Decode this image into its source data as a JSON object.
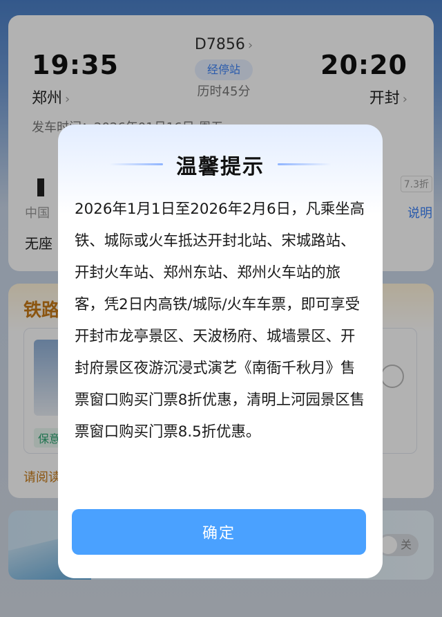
{
  "train": {
    "dep_time": "19:35",
    "dep_station": "郑州",
    "train_no": "D7856",
    "stops_label": "经停站",
    "duration": "历时45分",
    "arr_time": "20:20",
    "arr_station": "开封",
    "depart_date": "发车时间：2026年01月16日 周五"
  },
  "seat": {
    "discount_badge": "7.3折",
    "company": "中国",
    "explain_link": "说明",
    "seat_type": "无座"
  },
  "rail_card": {
    "title": "铁路",
    "tag": "保意",
    "read_text": "请阅读"
  },
  "banner": {
    "toggle_label": "关"
  },
  "dialog": {
    "title": "温馨提示",
    "body": "2026年1月1日至2026年2月6日，凡乘坐高铁、城际或火车抵达开封北站、宋城路站、开封火车站、郑州东站、郑州火车站的旅客，凭2日内高铁/城际/火车车票，即可享受开封市龙亭景区、天波杨府、城墙景区、开封府景区夜游沉浸式演艺《南衙千秋月》售票窗口购买门票8折优惠，清明上河园景区售票窗口购买门票8.5折优惠。",
    "confirm_label": "确定"
  },
  "colors": {
    "accent": "#4aa1ff",
    "link": "#3b82f6",
    "rail_title": "#c77a17"
  }
}
